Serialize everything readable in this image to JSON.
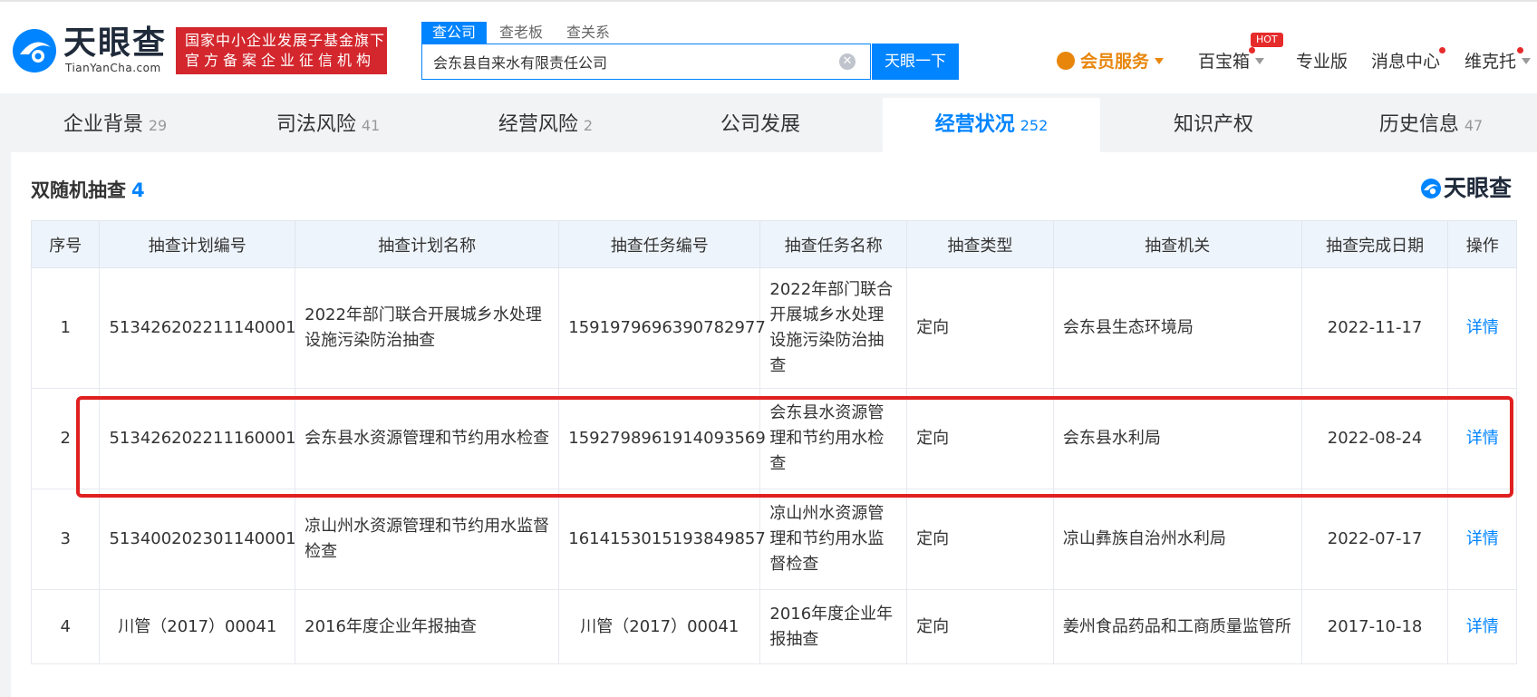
{
  "header": {
    "logo_text": "天眼查",
    "logo_sub": "TianYanCha.com",
    "badge_line1": "国家中小企业发展子基金旗下",
    "badge_line2": "官方备案企业征信机构",
    "search_tabs": [
      "查公司",
      "查老板",
      "查关系"
    ],
    "search_value": "会东县自来水有限责任公司",
    "search_button": "天眼一下",
    "vip_label": "会员服务",
    "nav": [
      "百宝箱",
      "专业版",
      "消息中心",
      "维克托"
    ],
    "hot_badge": "HOT",
    "accent_color": "#0084ff"
  },
  "tabs": [
    {
      "label": "企业背景",
      "count": "29"
    },
    {
      "label": "司法风险",
      "count": "41"
    },
    {
      "label": "经营风险",
      "count": "2"
    },
    {
      "label": "公司发展",
      "count": ""
    },
    {
      "label": "经营状况",
      "count": "252"
    },
    {
      "label": "知识产权",
      "count": ""
    },
    {
      "label": "历史信息",
      "count": "47"
    }
  ],
  "section": {
    "title": "双随机抽查",
    "count": "4",
    "brand": "天眼查"
  },
  "table": {
    "columns": [
      "序号",
      "抽查计划编号",
      "抽查计划名称",
      "抽查任务编号",
      "抽查任务名称",
      "抽查类型",
      "抽查机关",
      "抽查完成日期",
      "操作"
    ],
    "rows": [
      [
        "1",
        "513426202211140001",
        "2022年部门联合开展城乡水处理设施污染防治抽查",
        "1591979696390782977",
        "2022年部门联合开展城乡水处理设施污染防治抽查",
        "定向",
        "会东县生态环境局",
        "2022-11-17",
        "详情"
      ],
      [
        "2",
        "513426202211160001",
        "会东县水资源管理和节约用水检查",
        "1592798961914093569",
        "会东县水资源管理和节约用水检查",
        "定向",
        "会东县水利局",
        "2022-08-24",
        "详情"
      ],
      [
        "3",
        "513400202301140001",
        "凉山州水资源管理和节约用水监督检查",
        "1614153015193849857",
        "凉山州水资源管理和节约用水监督检查",
        "定向",
        "凉山彝族自治州水利局",
        "2022-07-17",
        "详情"
      ],
      [
        "4",
        "川管（2017）00041",
        "2016年度企业年报抽查",
        "川管（2017）00041",
        "2016年度企业年报抽查",
        "定向",
        "姜州食品药品和工商质量监管所",
        "2017-10-18",
        "详情"
      ]
    ]
  }
}
